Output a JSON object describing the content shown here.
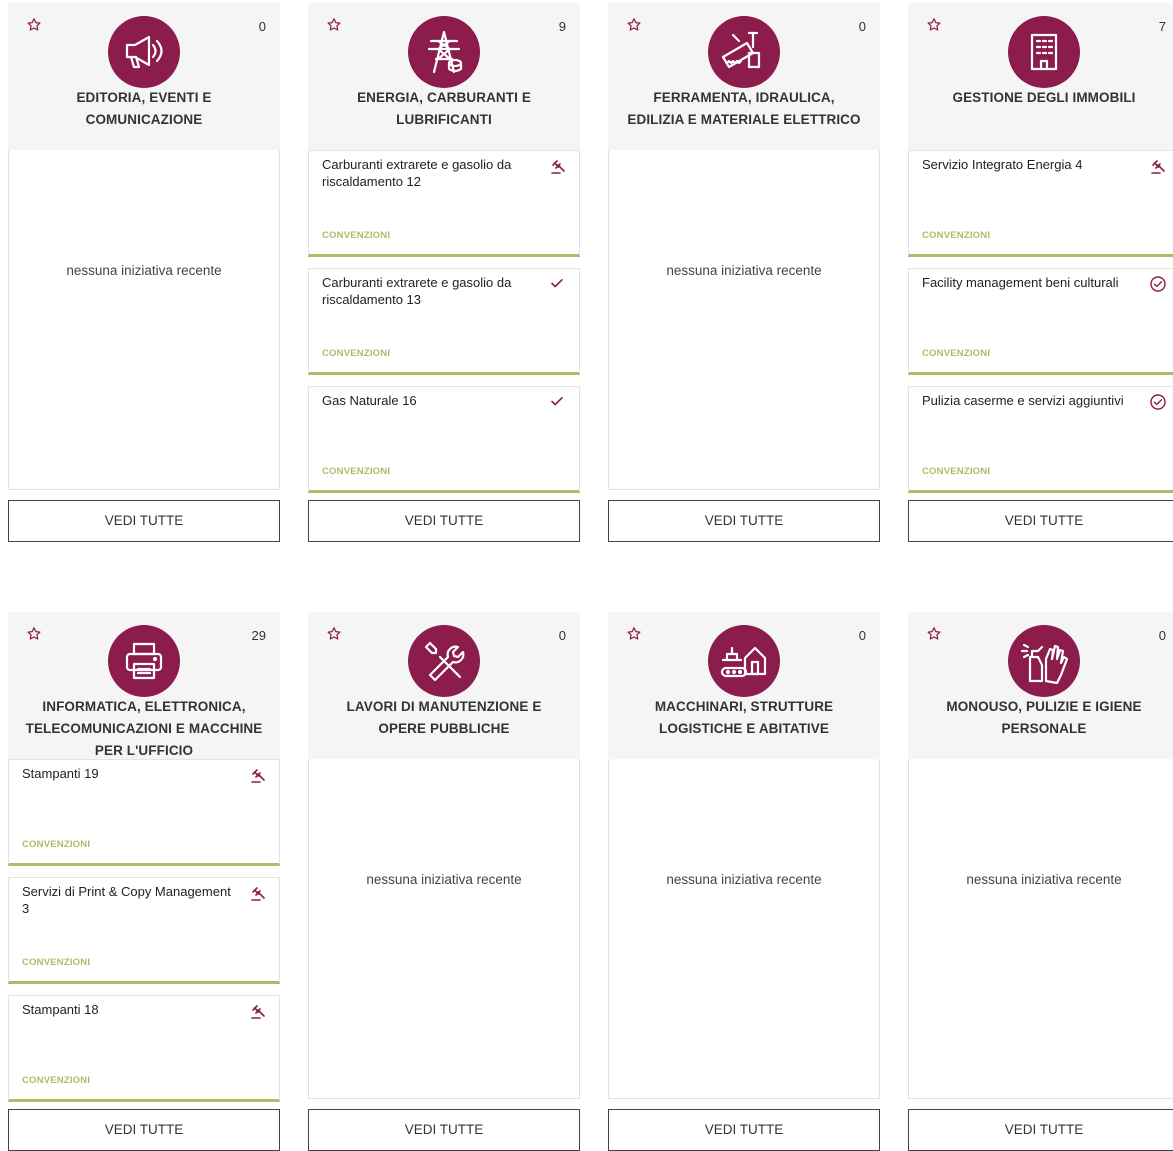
{
  "categories": [
    {
      "title_line1": "EDITORIA, EVENTI E",
      "title_line2": "COMUNICAZIONE",
      "title_line3": "",
      "count": "0",
      "icon": "megaphone-icon",
      "empty_text": "nessuna iniziativa recente",
      "items": [],
      "button": "VEDI TUTTE"
    },
    {
      "title_line1": "ENERGIA, CARBURANTI E",
      "title_line2": "LUBRIFICANTI",
      "title_line3": "",
      "count": "9",
      "icon": "power-pylon-icon",
      "empty_text": "",
      "items": [
        {
          "title": "Carburanti extrarete e gasolio da riscaldamento 12",
          "tag": "CONVENZIONI",
          "status": "auction-gavel-icon"
        },
        {
          "title": "Carburanti extrarete e gasolio da riscaldamento 13",
          "tag": "CONVENZIONI",
          "status": "check-icon"
        },
        {
          "title": "Gas Naturale 16",
          "tag": "CONVENZIONI",
          "status": "check-icon"
        }
      ],
      "button": "VEDI TUTTE"
    },
    {
      "title_line1": "FERRAMENTA, IDRAULICA,",
      "title_line2": "EDILIZIA E MATERIALE ELETTRICO",
      "title_line3": "",
      "count": "0",
      "icon": "tools-saw-icon",
      "empty_text": "nessuna iniziativa recente",
      "items": [],
      "button": "VEDI TUTTE"
    },
    {
      "title_line1": "GESTIONE DEGLI IMMOBILI",
      "title_line2": "",
      "title_line3": "",
      "count": "7",
      "icon": "building-icon",
      "empty_text": "",
      "items": [
        {
          "title": "Servizio Integrato Energia 4",
          "tag": "CONVENZIONI",
          "status": "auction-gavel-icon"
        },
        {
          "title": "Facility management beni culturali",
          "tag": "CONVENZIONI",
          "status": "check-circle-icon"
        },
        {
          "title": "Pulizia caserme e servizi aggiuntivi",
          "tag": "CONVENZIONI",
          "status": "check-circle-icon"
        }
      ],
      "button": "VEDI TUTTE"
    },
    {
      "title_line1": "INFORMATICA, ELETTRONICA,",
      "title_line2": "TELECOMUNICAZIONI E MACCHINE",
      "title_line3": "PER L'UFFICIO",
      "count": "29",
      "icon": "printer-icon",
      "empty_text": "",
      "items": [
        {
          "title": "Stampanti 19",
          "tag": "CONVENZIONI",
          "status": "auction-gavel-icon"
        },
        {
          "title": "Servizi di Print & Copy Management 3",
          "tag": "CONVENZIONI",
          "status": "auction-gavel-icon"
        },
        {
          "title": "Stampanti 18",
          "tag": "CONVENZIONI",
          "status": "auction-gavel-icon"
        }
      ],
      "button": "VEDI TUTTE"
    },
    {
      "title_line1": "LAVORI DI MANUTENZIONE E",
      "title_line2": "OPERE PUBBLICHE",
      "title_line3": "",
      "count": "0",
      "icon": "wrench-screwdriver-icon",
      "empty_text": "nessuna iniziativa recente",
      "items": [],
      "button": "VEDI TUTTE"
    },
    {
      "title_line1": "MACCHINARI, STRUTTURE",
      "title_line2": "LOGISTICHE E ABITATIVE",
      "title_line3": "",
      "count": "0",
      "icon": "machinery-house-icon",
      "empty_text": "nessuna iniziativa recente",
      "items": [],
      "button": "VEDI TUTTE"
    },
    {
      "title_line1": "MONOUSO, PULIZIE E IGIENE",
      "title_line2": "PERSONALE",
      "title_line3": "",
      "count": "0",
      "icon": "spray-glove-icon",
      "empty_text": "nessuna iniziativa recente",
      "items": [],
      "button": "VEDI TUTTE"
    }
  ],
  "colors": {
    "accent": "#8c1c4b",
    "tag_green": "#a8bf6a",
    "header_bg": "#f5f5f5"
  }
}
